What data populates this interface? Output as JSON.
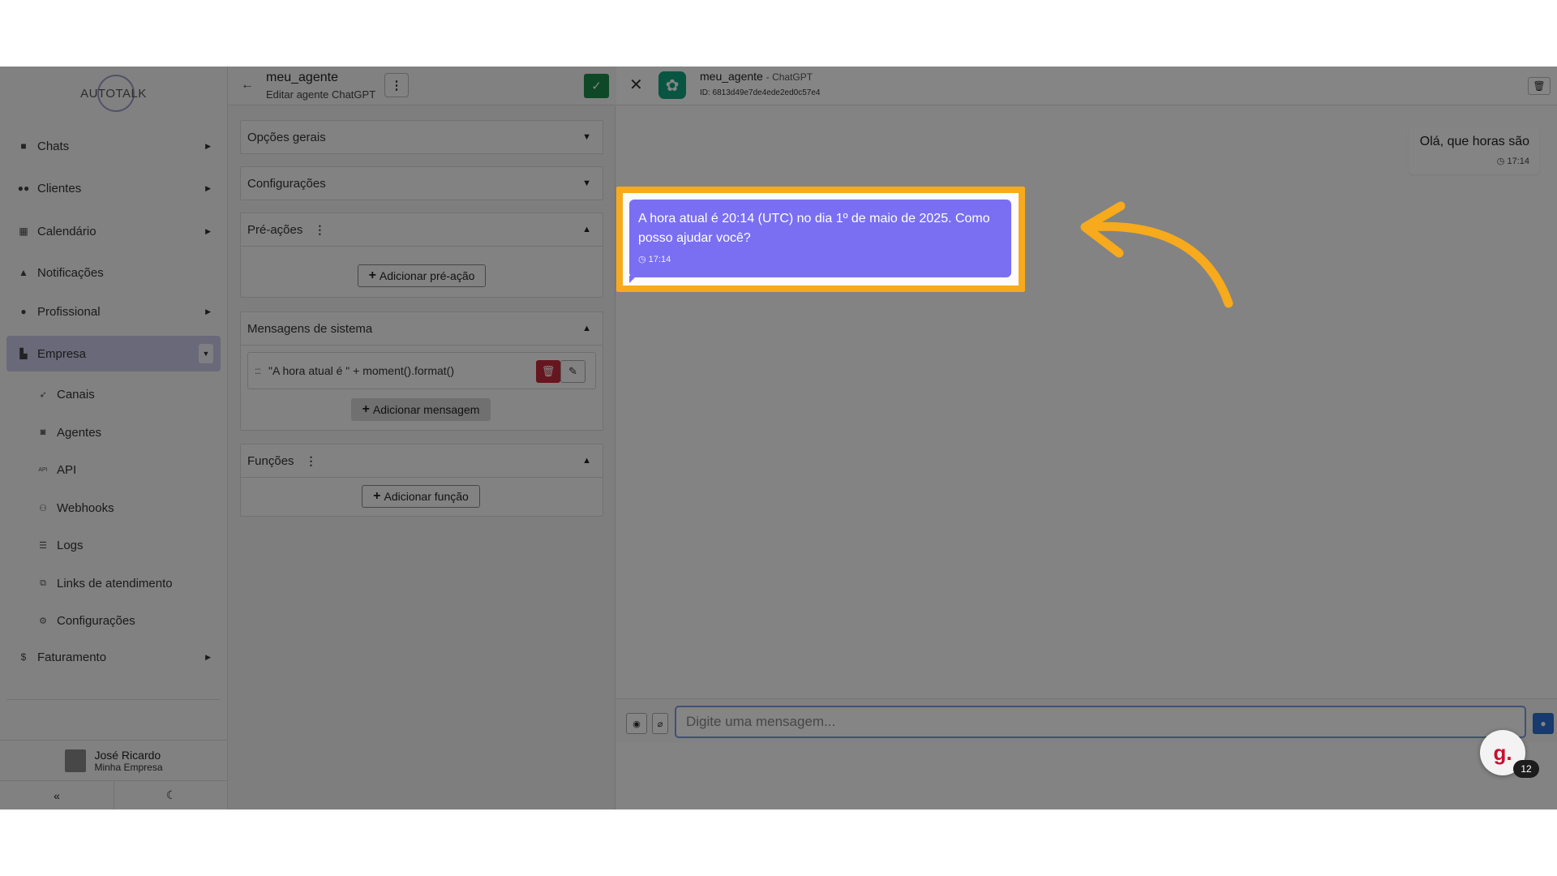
{
  "sidebar": {
    "logo_text": "AUTOTALK",
    "items": [
      {
        "label": "Chats",
        "icon": "chat-icon"
      },
      {
        "label": "Clientes",
        "icon": "users-icon"
      },
      {
        "label": "Calendário",
        "icon": "calendar-icon"
      },
      {
        "label": "Notificações",
        "icon": "bell-icon"
      },
      {
        "label": "Profissional",
        "icon": "user-tie-icon"
      },
      {
        "label": "Empresa",
        "icon": "building-icon"
      },
      {
        "label": "Faturamento",
        "icon": "dollar-icon"
      }
    ],
    "sub_items": [
      {
        "label": "Canais",
        "icon": "rocket-icon"
      },
      {
        "label": "Agentes",
        "icon": "robot-icon"
      },
      {
        "label": "API",
        "icon": "api-icon"
      },
      {
        "label": "Webhooks",
        "icon": "webhook-icon"
      },
      {
        "label": "Logs",
        "icon": "list-icon"
      },
      {
        "label": "Links de atendimento",
        "icon": "external-link-icon"
      },
      {
        "label": "Configurações",
        "icon": "gear-icon"
      }
    ],
    "user": {
      "name": "José Ricardo",
      "company": "Minha Empresa"
    }
  },
  "editor": {
    "agent_name": "meu_agente",
    "subtitle": "Editar agente ChatGPT",
    "sections": {
      "general": "Opções gerais",
      "config": "Configurações",
      "pre_actions": "Pré-ações",
      "add_pre_action": "Adicionar pré-ação",
      "system_messages": "Mensagens de sistema",
      "system_message_text": "\"A hora atual é \" + moment().format()",
      "add_message": "Adicionar mensagem",
      "functions": "Funções",
      "add_function": "Adicionar função"
    }
  },
  "chat": {
    "title": "meu_agente",
    "title_suffix": "- ChatGPT",
    "id_line": "ID: 6813d49e7de4ede2ed0c57e4",
    "user_message": {
      "text": "Olá, que horas são",
      "time": "17:14"
    },
    "bot_message": {
      "text": "A hora atual é 20:14 (UTC) no dia 1º de maio de 2025. Como posso ajudar você?",
      "time": "17:14"
    },
    "input_placeholder": "Digite uma mensagem...",
    "highlight_color": "#f6aa1c"
  },
  "help": {
    "badge_count": "12",
    "letter": "g."
  }
}
